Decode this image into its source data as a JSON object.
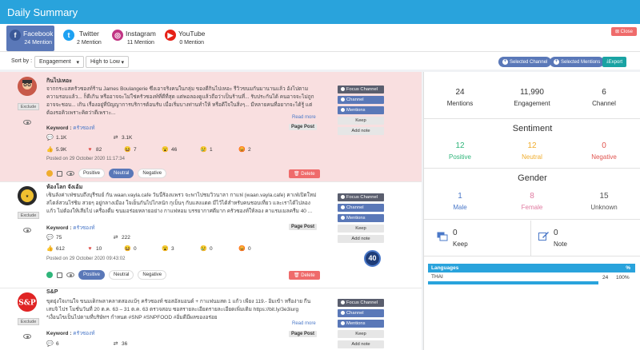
{
  "header": {
    "title": "Daily Summary"
  },
  "tabs": [
    {
      "name": "Facebook",
      "count": "24 Mention",
      "icon": "facebook-icon",
      "color": "#3b5998",
      "active": true
    },
    {
      "name": "Twitter",
      "count": "2 Mention",
      "icon": "twitter-icon",
      "color": "#1da1f2",
      "active": false
    },
    {
      "name": "Instagram",
      "count": "11 Mention",
      "icon": "instagram-icon",
      "color": "#c13584",
      "active": false
    },
    {
      "name": "YouTube",
      "count": "0 Mention",
      "icon": "youtube-icon",
      "color": "#e62117",
      "active": false
    }
  ],
  "close_label": "Close",
  "sort": {
    "label": "Sort by :",
    "field": "Engagement",
    "order": "High to Low"
  },
  "filters": {
    "channel": "Selected Channel",
    "mentions": "Selected Mentions",
    "export": "Export"
  },
  "actions": {
    "focus": "Focus Channel",
    "channel": "Channel",
    "mentions": "Mentions",
    "keep": "Keep",
    "note": "Add note",
    "exclude": "Exclude",
    "readmore": "Read more",
    "keyword_label": "Keyword :",
    "delete": "Delete",
    "positive": "Positive",
    "neutral": "Neutral",
    "negative": "Negative"
  },
  "posts": [
    {
      "name": "กินไปเหอะ",
      "text": "จากกระแสครัวซองท์ร้าน James Boulangerie ซึ่งเอาจริงคนในกลุ่ม ของดีกินไปเหอะ รีวิวขนมกันมานานแล้ว อังไปตามความรอบแล้ว... ก็ดีเกิน หรืออาจจะไม่ใช่ครัวซองท์ที่ดีที่สุด แต่พอลองดูแล้วถือว่าเป็นร้านที่... รับประกันได้ คนอาจจะไม่ถูก อาจจะชอบ... เกิน เรื่องอยู่ที่ปัญญาการบริการต้อนรับ เมื่อเริ่มบางท่านทำให้ หรือดีใจในสิ่งๆ... มีหลายคนที่อยากจะได้รู้ แต่ต้องรอคิวเพราะคิดว่าดีเพราะ...",
      "keyword": "ครัวซองท์",
      "type": "Page Post",
      "comments": "1.1K",
      "shares": "3.1K",
      "reactions": [
        "5.9K",
        "82",
        "7",
        "46",
        "1",
        "2"
      ],
      "posted": "Posted on 29 October 2020 11:17:34",
      "sentiment": "neutral"
    },
    {
      "name": "ห้องโลก จังเอ้ม",
      "text": "เซ็นลังค่าเฟ่ชนบถึงบุรีรมย์ กัน waan.vayla.cafe วันนี้ร้องแพรว จะพาไปชมวิวนาลา กาแฟ (waan.vayla.cafe) คาเฟ่เปิดใหม่ สไตล์สวนไร่ชิม สวยๆ อยู่กลางเมือง ใจเย็นกันไปไกลนัก กุเบ็นๆ กับแสงแดด มีไว้ได้สำหรับคนชอบเที่ยว และเราได้ไปลอง แก้ว ไม่ต้องให้เสียไป เครื่องดื่ม ขนมอร่อยหลายอย่าง กาแฟหอม บรรยากาศดีมาก ครัวซองท์ให้ลอง คาแรมเมลครีม 40 ...",
      "keyword": "ครัวซองท์",
      "type": "Page Post",
      "comments": "75",
      "shares": "222",
      "reactions": [
        "612",
        "10",
        "0",
        "3",
        "0",
        "0"
      ],
      "posted": "Posted on 29 October 2020 09:43:02",
      "sentiment": "positive",
      "badge": "40"
    },
    {
      "name": "S&P",
      "text": "ขุดยุ่งใจเกนใจ ขนมเด็กพลาคลาตสองแบ้ๆ ครัวซองท์ ซอสอัลมอนด์ + กาแฟนมสด 1 แก้ว เพียง 119.- อิ่มเข้า หรือง่าย กีนเสบจิ ไปร โมชั่นวันที่ 20 ต.ค. 63 – 31 ต.ค. 63 ตรวจสอบ ซอสรายละเอียดรายละเอียดเพิ่มเติม https://bit.ly/3e3iurg *เงื่อนไขเป็นไปตามที่บริษัทฯ กำหนด #SNP #SNPFOOD #อิ่มดีมีผลของอร่อย",
      "keyword": "ครัวซองท์",
      "type": "Page Post",
      "comments": "6",
      "shares": "36",
      "reactions": [
        "",
        "",
        "",
        "",
        "",
        ""
      ],
      "posted": "",
      "sentiment": ""
    }
  ],
  "summary": {
    "mentions": {
      "value": "24",
      "label": "Mentions"
    },
    "engagement": {
      "value": "11,990",
      "label": "Engagement"
    },
    "channel": {
      "value": "6",
      "label": "Channel"
    }
  },
  "sentiment": {
    "title": "Sentiment",
    "positive": {
      "value": "12",
      "label": "Positive",
      "color": "#2fb57a"
    },
    "neutral": {
      "value": "12",
      "label": "Neutral",
      "color": "#f0ad2e"
    },
    "negative": {
      "value": "0",
      "label": "Negative",
      "color": "#e0544f"
    }
  },
  "gender": {
    "title": "Gender",
    "male": {
      "value": "1",
      "label": "Male",
      "color": "#4a78c8"
    },
    "female": {
      "value": "8",
      "label": "Female",
      "color": "#e07aa0"
    },
    "unknown": {
      "value": "15",
      "label": "Unknown",
      "color": "#555555"
    }
  },
  "keep": {
    "value": "0",
    "label": "Keep"
  },
  "note": {
    "value": "0",
    "label": "Note"
  },
  "languages": {
    "header": "Languages",
    "pct_header": "%",
    "rows": [
      {
        "name": "THAI",
        "count": "24",
        "pct": "100%",
        "fill": 1
      }
    ]
  }
}
